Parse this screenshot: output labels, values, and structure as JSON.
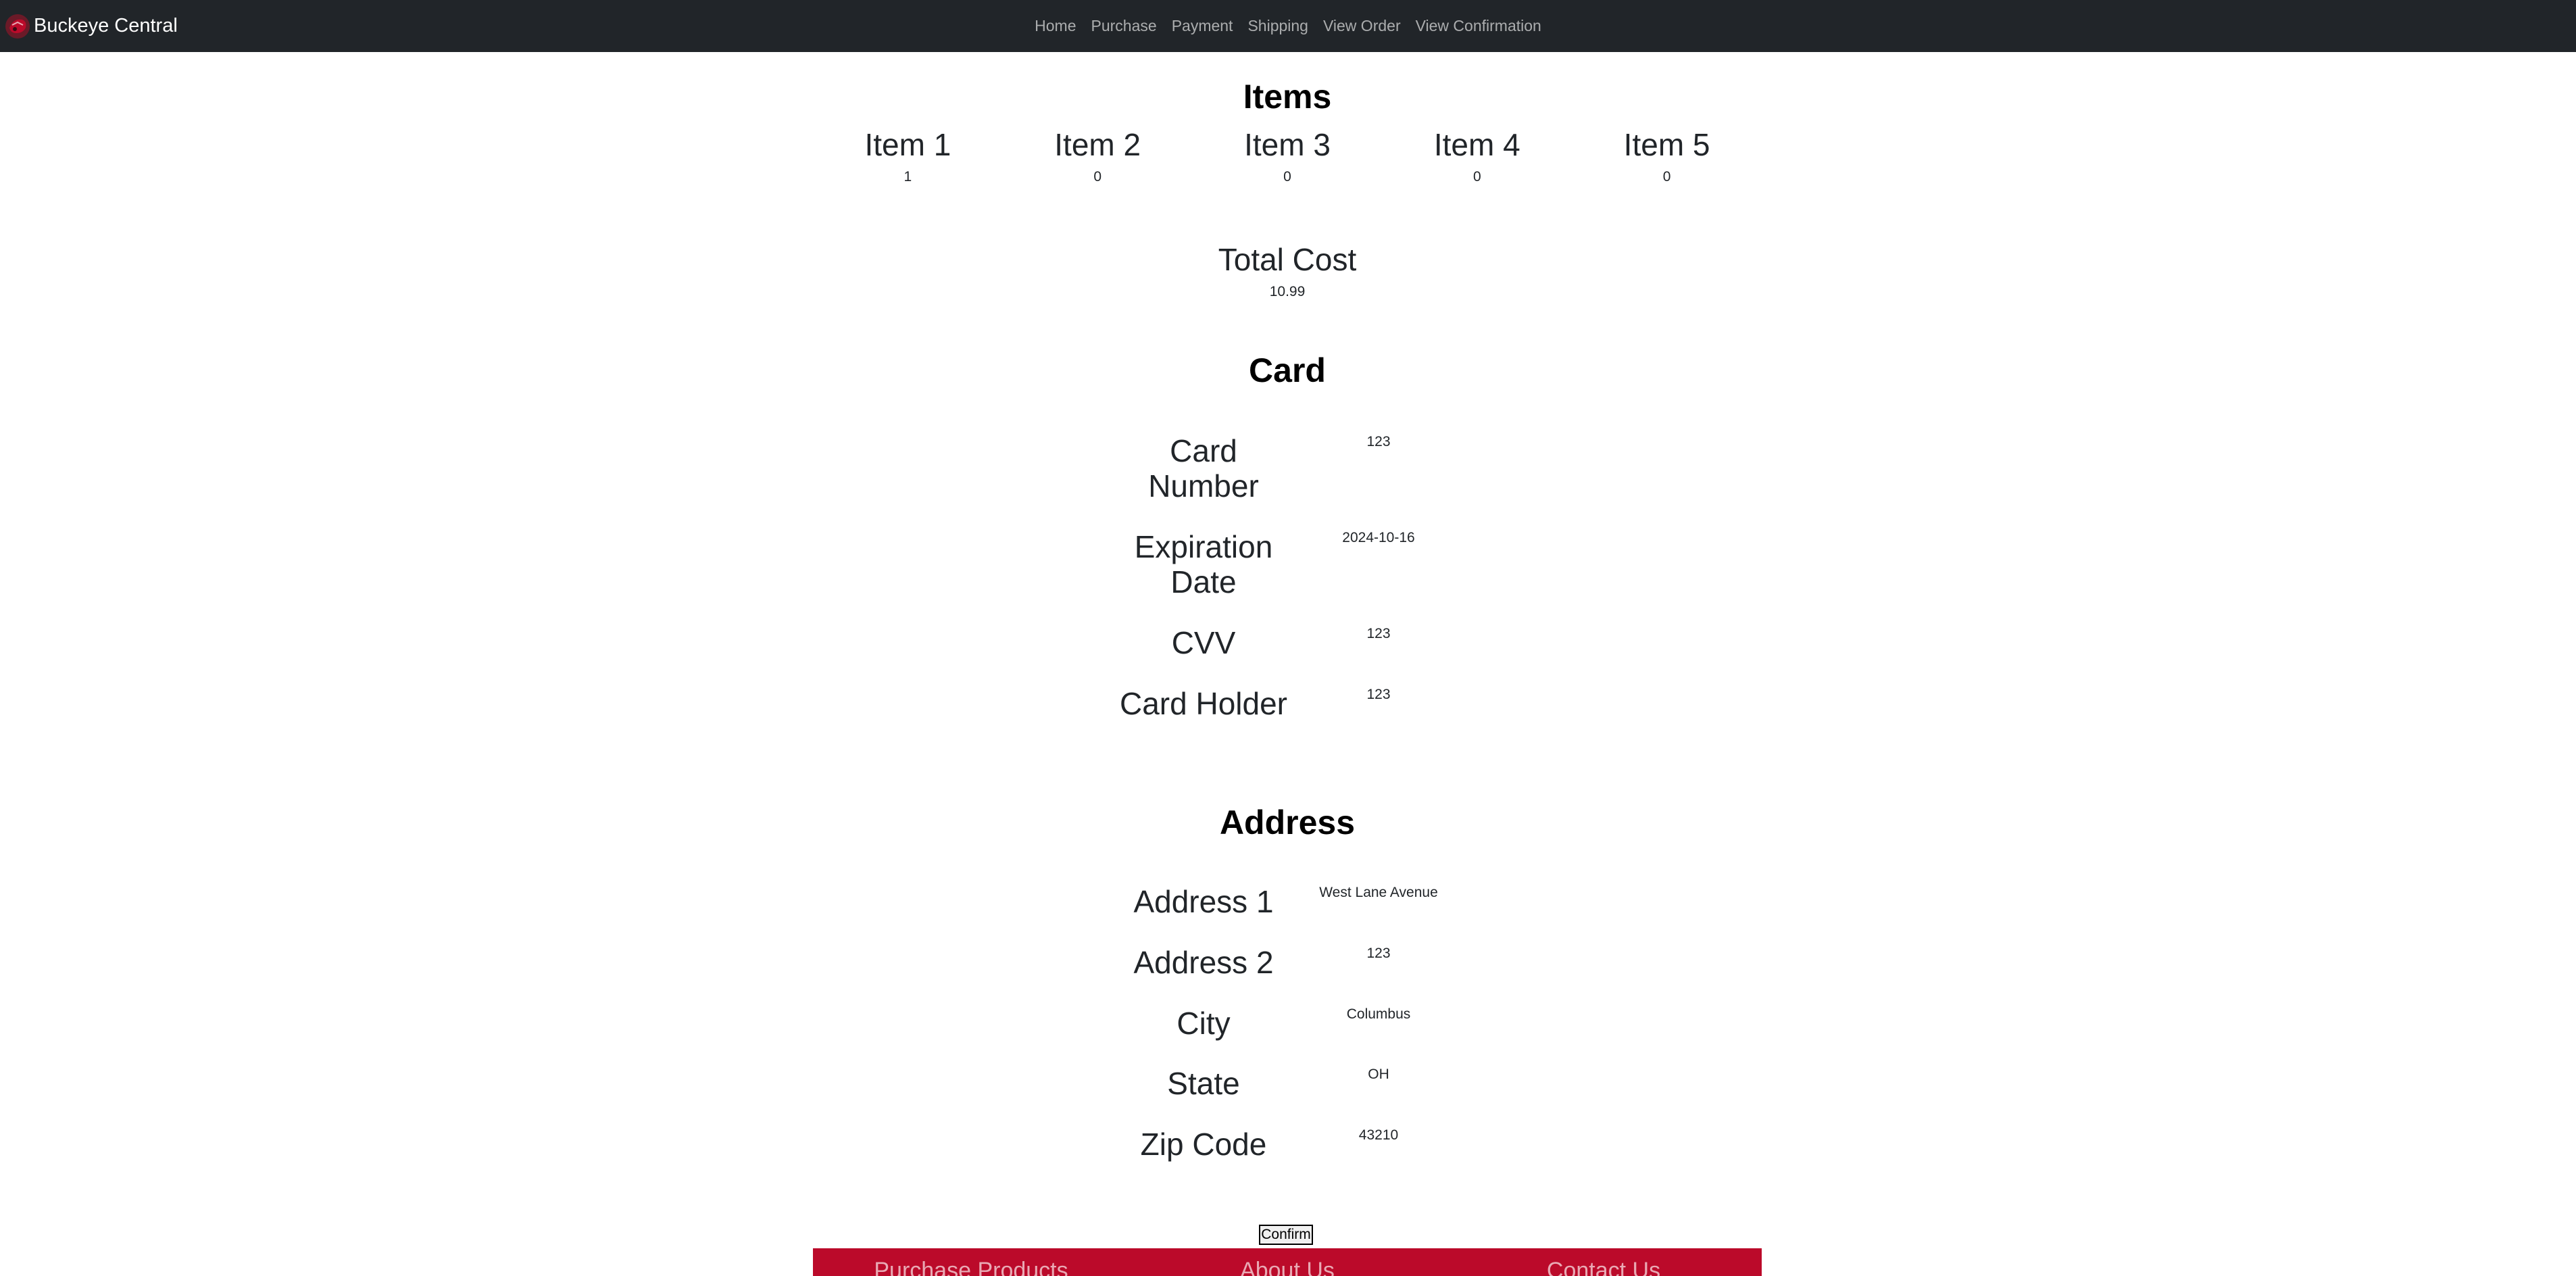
{
  "navbar": {
    "brand": "Buckeye Central",
    "links": [
      "Home",
      "Purchase",
      "Payment",
      "Shipping",
      "View Order",
      "View Confirmation"
    ]
  },
  "items": {
    "title": "Items",
    "list": [
      {
        "name": "Item 1",
        "qty": "1"
      },
      {
        "name": "Item 2",
        "qty": "0"
      },
      {
        "name": "Item 3",
        "qty": "0"
      },
      {
        "name": "Item 4",
        "qty": "0"
      },
      {
        "name": "Item 5",
        "qty": "0"
      }
    ]
  },
  "total": {
    "label": "Total Cost",
    "value": "10.99"
  },
  "card": {
    "title": "Card",
    "fields": [
      {
        "label": "Card Number",
        "value": "123"
      },
      {
        "label": "Expiration Date",
        "value": "2024-10-16"
      },
      {
        "label": "CVV",
        "value": "123"
      },
      {
        "label": "Card Holder",
        "value": "123"
      }
    ]
  },
  "address": {
    "title": "Address",
    "fields": [
      {
        "label": "Address 1",
        "value": "West Lane Avenue"
      },
      {
        "label": "Address 2",
        "value": "123"
      },
      {
        "label": "City",
        "value": "Columbus"
      },
      {
        "label": "State",
        "value": "OH"
      },
      {
        "label": "Zip Code",
        "value": "43210"
      }
    ]
  },
  "confirm_label": "Confirm",
  "footer": {
    "links": [
      "Purchase Products",
      "About Us",
      "Contact Us"
    ]
  },
  "colors": {
    "navbar_bg": "#212529",
    "footer_bg": "#bb0a2a"
  },
  "icons": {
    "brand_logo": "buckeye-logo-icon"
  }
}
